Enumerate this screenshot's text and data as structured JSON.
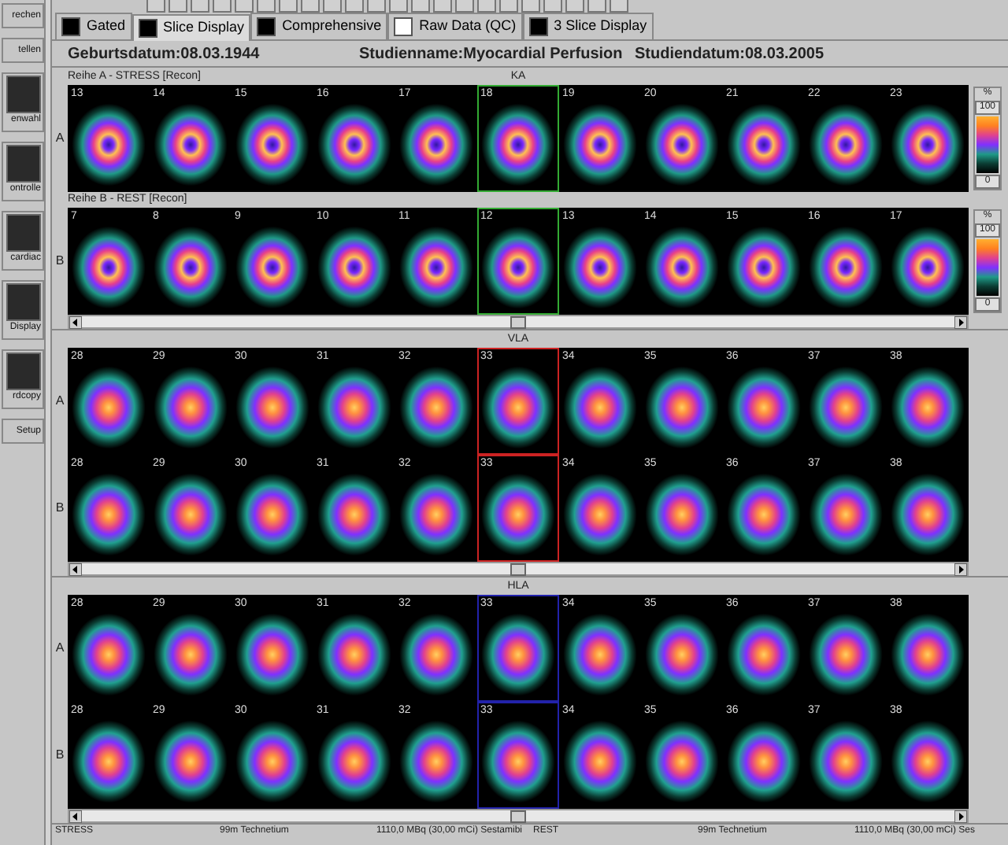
{
  "sidebar": {
    "items": [
      {
        "label": "rechen",
        "kind": "plain"
      },
      {
        "label": "tellen",
        "kind": "plain"
      },
      {
        "label": "enwahl",
        "kind": "icon"
      },
      {
        "label": "ontrolle",
        "kind": "icon"
      },
      {
        "label": "cardiac",
        "kind": "icon"
      },
      {
        "label": "Display",
        "kind": "icon"
      },
      {
        "label": "rdcopy",
        "kind": "icon"
      },
      {
        "label": "Setup",
        "kind": "plain"
      }
    ]
  },
  "tabs": [
    {
      "label": "Gated",
      "selected": false,
      "color": "#000000"
    },
    {
      "label": "Slice Display",
      "selected": true,
      "color": "#000000"
    },
    {
      "label": "Comprehensive",
      "selected": false,
      "color": "#000000"
    },
    {
      "label": "Raw Data (QC)",
      "selected": false,
      "color": "#ffffff"
    },
    {
      "label": "3 Slice Display",
      "selected": false,
      "color": "#000000"
    }
  ],
  "header": {
    "birth_date": "Geburtsdatum:08.03.1944",
    "study_name": "Studienname:Myocardial Perfusion",
    "study_date": "Studiendatum:08.03.2005"
  },
  "panels": [
    {
      "kind": "ring",
      "title": "KA",
      "color": "#33aa33",
      "rows": [
        {
          "caption": "Reihe A - STRESS [Recon]",
          "label": "A",
          "slices": [
            {
              "number": "13",
              "selected": false
            },
            {
              "number": "14",
              "selected": false
            },
            {
              "number": "15",
              "selected": false
            },
            {
              "number": "16",
              "selected": false
            },
            {
              "number": "17",
              "selected": false
            },
            {
              "number": "18",
              "selected": true
            },
            {
              "number": "19",
              "selected": false
            },
            {
              "number": "20",
              "selected": false
            },
            {
              "number": "21",
              "selected": false
            },
            {
              "number": "22",
              "selected": false
            },
            {
              "number": "23",
              "selected": false
            }
          ],
          "scale": {
            "unit": "%",
            "max": "100",
            "min": "0"
          }
        },
        {
          "caption": "Reihe B - REST [Recon]",
          "label": "B",
          "slices": [
            {
              "number": "7",
              "selected": false
            },
            {
              "number": "8",
              "selected": false
            },
            {
              "number": "9",
              "selected": false
            },
            {
              "number": "10",
              "selected": false
            },
            {
              "number": "11",
              "selected": false
            },
            {
              "number": "12",
              "selected": true
            },
            {
              "number": "13",
              "selected": false
            },
            {
              "number": "14",
              "selected": false
            },
            {
              "number": "15",
              "selected": false
            },
            {
              "number": "16",
              "selected": false
            },
            {
              "number": "17",
              "selected": false
            }
          ],
          "scale": {
            "unit": "%",
            "max": "100",
            "min": "0"
          }
        }
      ]
    },
    {
      "kind": "blob",
      "title": "VLA",
      "color": "#cc2222",
      "rows": [
        {
          "label": "A",
          "slices": [
            {
              "number": "28",
              "selected": false
            },
            {
              "number": "29",
              "selected": false
            },
            {
              "number": "30",
              "selected": false
            },
            {
              "number": "31",
              "selected": false
            },
            {
              "number": "32",
              "selected": false
            },
            {
              "number": "33",
              "selected": true
            },
            {
              "number": "34",
              "selected": false
            },
            {
              "number": "35",
              "selected": false
            },
            {
              "number": "36",
              "selected": false
            },
            {
              "number": "37",
              "selected": false
            },
            {
              "number": "38",
              "selected": false
            }
          ]
        },
        {
          "label": "B",
          "slices": [
            {
              "number": "28",
              "selected": false
            },
            {
              "number": "29",
              "selected": false
            },
            {
              "number": "30",
              "selected": false
            },
            {
              "number": "31",
              "selected": false
            },
            {
              "number": "32",
              "selected": false
            },
            {
              "number": "33",
              "selected": true
            },
            {
              "number": "34",
              "selected": false
            },
            {
              "number": "35",
              "selected": false
            },
            {
              "number": "36",
              "selected": false
            },
            {
              "number": "37",
              "selected": false
            },
            {
              "number": "38",
              "selected": false
            }
          ]
        }
      ]
    },
    {
      "kind": "blob",
      "title": "HLA",
      "color": "#2222aa",
      "rows": [
        {
          "label": "A",
          "slices": [
            {
              "number": "28",
              "selected": false
            },
            {
              "number": "29",
              "selected": false
            },
            {
              "number": "30",
              "selected": false
            },
            {
              "number": "31",
              "selected": false
            },
            {
              "number": "32",
              "selected": false
            },
            {
              "number": "33",
              "selected": true
            },
            {
              "number": "34",
              "selected": false
            },
            {
              "number": "35",
              "selected": false
            },
            {
              "number": "36",
              "selected": false
            },
            {
              "number": "37",
              "selected": false
            },
            {
              "number": "38",
              "selected": false
            }
          ]
        },
        {
          "label": "B",
          "slices": [
            {
              "number": "28",
              "selected": false
            },
            {
              "number": "29",
              "selected": false
            },
            {
              "number": "30",
              "selected": false
            },
            {
              "number": "31",
              "selected": false
            },
            {
              "number": "32",
              "selected": false
            },
            {
              "number": "33",
              "selected": true
            },
            {
              "number": "34",
              "selected": false
            },
            {
              "number": "35",
              "selected": false
            },
            {
              "number": "36",
              "selected": false
            },
            {
              "number": "37",
              "selected": false
            },
            {
              "number": "38",
              "selected": false
            }
          ]
        }
      ]
    }
  ],
  "status_bar": [
    {
      "text": "STRESS"
    },
    {
      "text": "99m Technetium"
    },
    {
      "text": "1110,0 MBq (30,00 mCi) Sestamibi"
    },
    {
      "text": "REST"
    },
    {
      "text": "99m Technetium"
    },
    {
      "text": "1110,0 MBq (30,00 mCi) Ses"
    }
  ]
}
